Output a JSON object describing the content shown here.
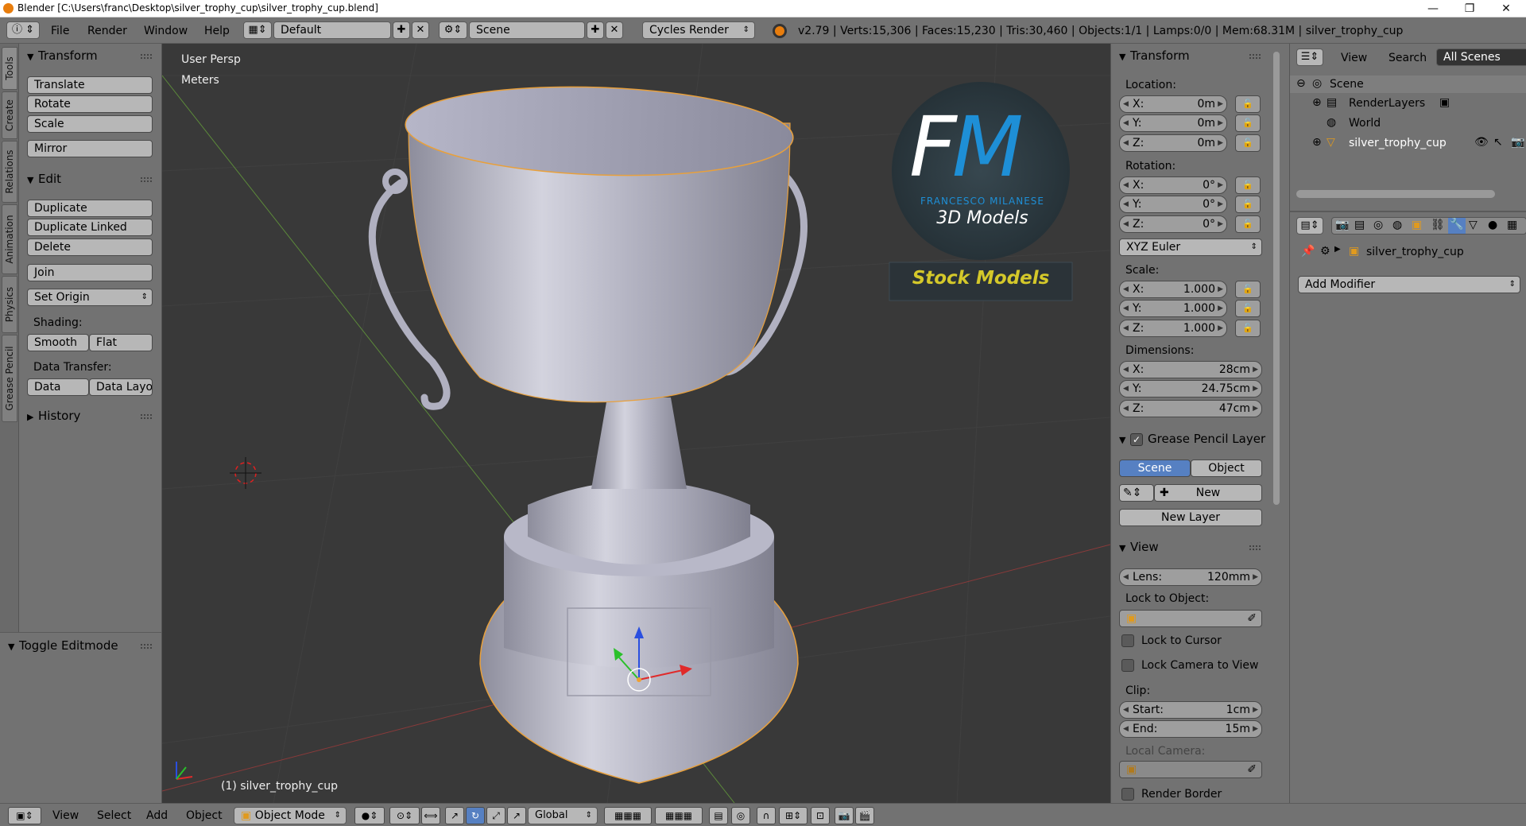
{
  "window": {
    "title": "Blender [C:\\Users\\franc\\Desktop\\silver_trophy_cup\\silver_trophy_cup.blend]",
    "minimize": "—",
    "maximize": "❐",
    "close": "✕"
  },
  "menu": {
    "items": [
      "File",
      "Render",
      "Window",
      "Help"
    ],
    "layout": "Default",
    "scene": "Scene",
    "engine": "Cycles Render",
    "stats": "v2.79 | Verts:15,306 | Faces:15,230 | Tris:30,460 | Objects:1/1 | Lamps:0/0 | Mem:68.31M | silver_trophy_cup"
  },
  "tabs": [
    "Tools",
    "Create",
    "Relations",
    "Animation",
    "Physics",
    "Grease Pencil"
  ],
  "toolshelf": {
    "transform_header": "Transform",
    "translate": "Translate",
    "rotate": "Rotate",
    "scale": "Scale",
    "mirror": "Mirror",
    "edit_header": "Edit",
    "duplicate": "Duplicate",
    "duplicate_linked": "Duplicate Linked",
    "delete": "Delete",
    "join": "Join",
    "set_origin": "Set Origin",
    "shading_label": "Shading:",
    "smooth": "Smooth",
    "flat": "Flat",
    "data_transfer_label": "Data Transfer:",
    "data": "Data",
    "data_layout": "Data Layo",
    "history_header": "History",
    "toggle_editmode": "Toggle Editmode"
  },
  "viewport": {
    "view_name": "User Persp",
    "units": "Meters",
    "object_label": "(1) silver_trophy_cup",
    "logo_letters": "FM",
    "logo_name": "FRANCESCO MILANESE",
    "logo_sub": "3D Models",
    "stock_label": "Stock Models"
  },
  "npanel": {
    "transform_header": "Transform",
    "location_label": "Location:",
    "location": [
      {
        "axis": "X:",
        "value": "0m"
      },
      {
        "axis": "Y:",
        "value": "0m"
      },
      {
        "axis": "Z:",
        "value": "0m"
      }
    ],
    "rotation_label": "Rotation:",
    "rotation": [
      {
        "axis": "X:",
        "value": "0°"
      },
      {
        "axis": "Y:",
        "value": "0°"
      },
      {
        "axis": "Z:",
        "value": "0°"
      }
    ],
    "rotation_mode": "XYZ Euler",
    "scale_label": "Scale:",
    "scale": [
      {
        "axis": "X:",
        "value": "1.000"
      },
      {
        "axis": "Y:",
        "value": "1.000"
      },
      {
        "axis": "Z:",
        "value": "1.000"
      }
    ],
    "dimensions_label": "Dimensions:",
    "dimensions": [
      {
        "axis": "X:",
        "value": "28cm"
      },
      {
        "axis": "Y:",
        "value": "24.75cm"
      },
      {
        "axis": "Z:",
        "value": "47cm"
      }
    ],
    "grease_header": "Grease Pencil Layer",
    "scene_tab": "Scene",
    "object_tab": "Object",
    "new": "New",
    "new_layer": "New Layer",
    "view_header": "View",
    "lens_label": "Lens:",
    "lens_value": "120mm",
    "lock_object_label": "Lock to Object:",
    "lock_cursor": "Lock to Cursor",
    "lock_camera": "Lock Camera to View",
    "clip_label": "Clip:",
    "clip_start_label": "Start:",
    "clip_start": "1cm",
    "clip_end_label": "End:",
    "clip_end": "15m",
    "local_camera_label": "Local Camera:",
    "render_border": "Render Border"
  },
  "outliner": {
    "view": "View",
    "search": "Search",
    "filter": "All Scenes",
    "items": [
      "Scene",
      "RenderLayers",
      "World",
      "silver_trophy_cup"
    ]
  },
  "properties": {
    "object_name": "silver_trophy_cup",
    "add_modifier": "Add Modifier"
  },
  "footer": {
    "view": "View",
    "select": "Select",
    "add": "Add",
    "object": "Object",
    "mode": "Object Mode",
    "orientation": "Global"
  },
  "colors": {
    "accent": "#5680c2",
    "selection": "#f0a030",
    "panel": "#727272",
    "viewport": "#393939",
    "logo_blue": "#1e8fd6",
    "stock_yellow": "#d4c82a"
  }
}
